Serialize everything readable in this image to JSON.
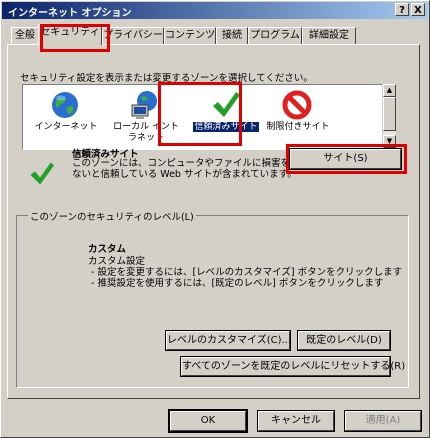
{
  "window": {
    "title": "インターネット オプション",
    "help_btn": "?",
    "close_btn": "X"
  },
  "tabs": [
    {
      "label": "全般"
    },
    {
      "label": "セキュリティ"
    },
    {
      "label": "プライバシー"
    },
    {
      "label": "コンテンツ"
    },
    {
      "label": "接続"
    },
    {
      "label": "プログラム"
    },
    {
      "label": "詳細設定"
    }
  ],
  "security": {
    "instruction": "セキュリティ設定を表示または変更するゾーンを選択してください。",
    "zones": [
      {
        "label": "インターネット",
        "icon": "globe-icon"
      },
      {
        "label": "ローカル イント\nラネット",
        "icon": "local-intranet-icon"
      },
      {
        "label": "信頼済みサイト",
        "icon": "checkmark-icon"
      },
      {
        "label": "制限付きサイト",
        "icon": "restricted-icon"
      }
    ],
    "selected_zone": {
      "name": "信頼済みサイト",
      "description": "このゾーンには、コンピュータやファイルに損害を与え\nないと信頼している Web サイトが含まれています。"
    },
    "sites_button": "サイト(S)",
    "level_group": {
      "title": "このゾーンのセキュリティのレベル(L)",
      "level_name": "カスタム",
      "level_details": "カスタム設定\n - 設定を変更するには、[レベルのカスタマイズ] ボタンをクリックします\n - 推奨設定を使用するには、[既定のレベル] ボタンをクリックします",
      "customize_button": "レベルのカスタマイズ(C)...",
      "default_button": "既定のレベル(D)"
    },
    "reset_all_button": "すべてのゾーンを既定のレベルにリセットする(R)"
  },
  "footer": {
    "ok": "OK",
    "cancel": "キャンセル",
    "apply": "適用(A)"
  },
  "colors": {
    "titlebar_start": "#0a246a",
    "titlebar_end": "#a6caf0",
    "highlight_box": "#e00000",
    "selection": "#0a246a"
  }
}
